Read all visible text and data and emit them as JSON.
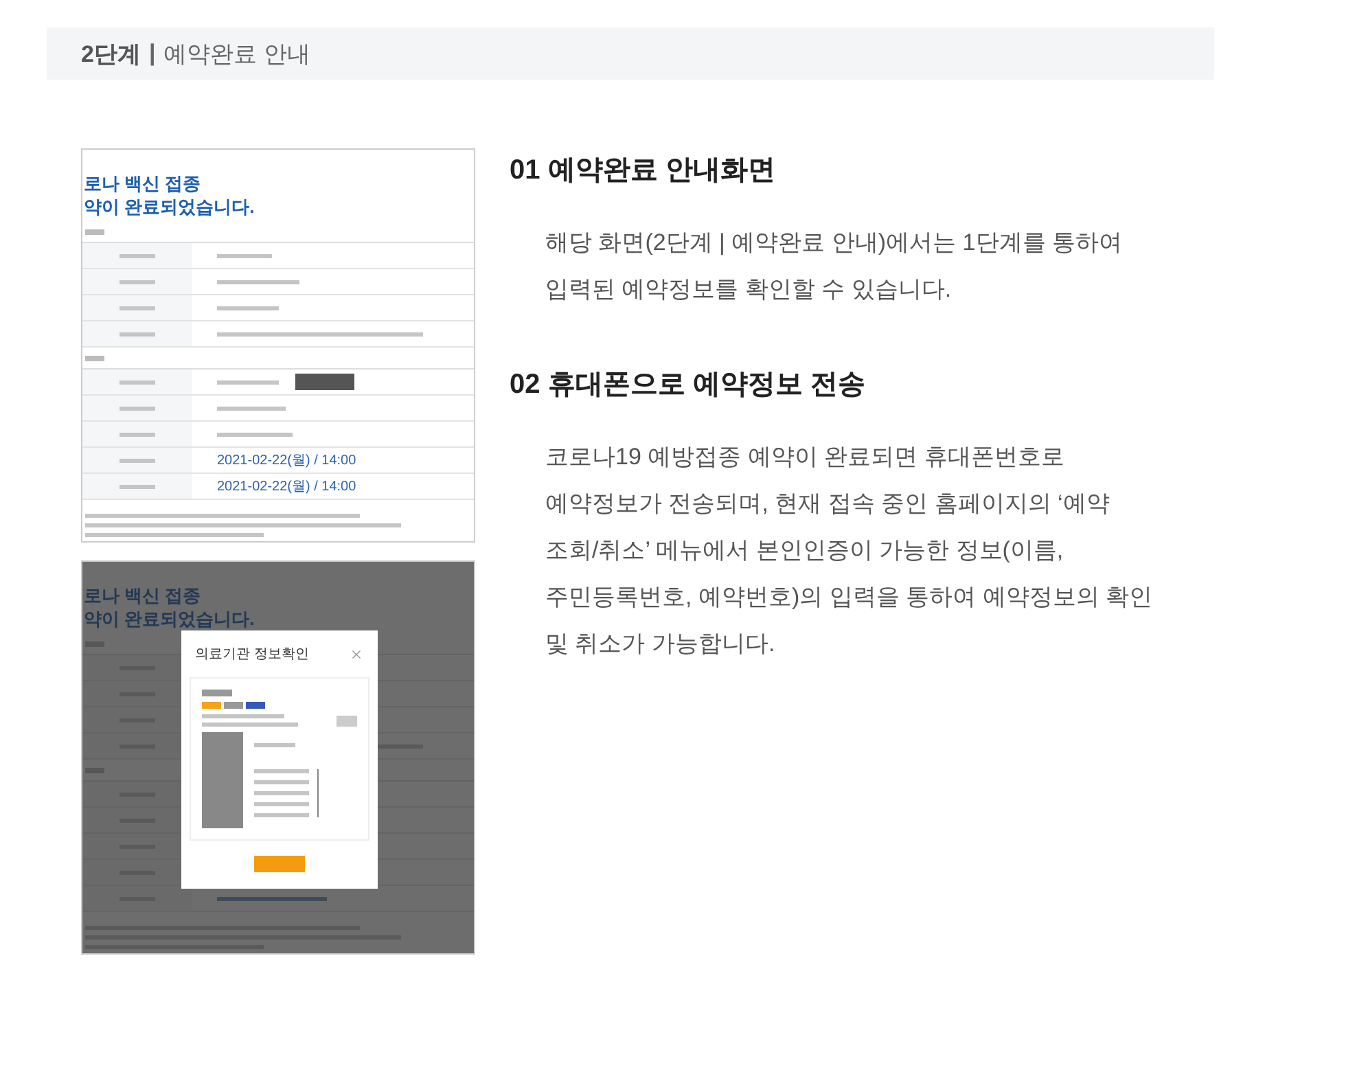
{
  "header": {
    "step": "2단계",
    "separator": "|",
    "title": "예약완료 안내"
  },
  "screens": [
    {
      "kind": "page",
      "heading": [
        "로나 백신 접종",
        "약이 완료되었습니다."
      ],
      "dates": [
        "2021-02-22(월) / 14:00",
        "2021-02-22(월) / 14:00"
      ]
    },
    {
      "kind": "modal",
      "heading": [
        "로나 백신 접종",
        "약이 완료되었습니다."
      ],
      "modal_title": "의료기관 정보확인"
    }
  ],
  "sections": [
    {
      "title": "01 예약완료 안내화면",
      "lines": [
        "해당 화면(2단계 | 예약완료 안내)에서는 1단계를 통하여",
        "입력된 예약정보를 확인할 수 있습니다."
      ]
    },
    {
      "title": "02 휴대폰으로 예약정보 전송",
      "lines": [
        "코로나19 예방접종 예약이 완료되면 휴대폰번호로",
        "예약정보가 전송되며, 현재 접속 중인 홈페이지의 ‘예약",
        "조회/취소’ 메뉴에서 본인인증이 가능한 정보(이름,",
        "주민등록번호, 예약번호)의 입력을 통하여 예약정보의 확인",
        "및 취소가 가능합니다."
      ]
    }
  ]
}
